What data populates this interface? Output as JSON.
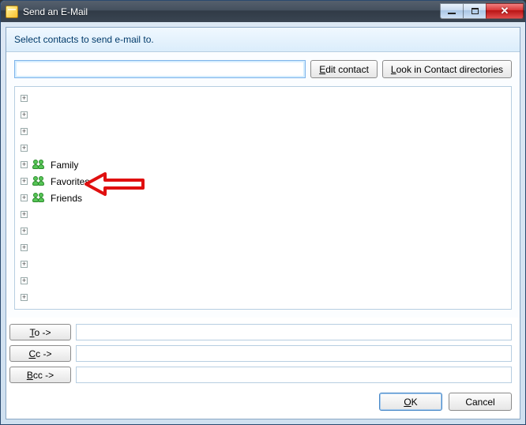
{
  "window": {
    "title": "Send an E-Mail"
  },
  "instruction": "Select contacts to send e-mail to.",
  "search": {
    "value": "",
    "placeholder": ""
  },
  "buttons": {
    "edit_contact": "Edit contact",
    "look_in_dirs": "Look in Contact directories",
    "to": "To ->",
    "cc": "Cc ->",
    "bcc": "Bcc ->",
    "ok": "OK",
    "cancel": "Cancel"
  },
  "contact_list": [
    {
      "type": "contact",
      "label": ""
    },
    {
      "type": "contact",
      "label": ""
    },
    {
      "type": "contact",
      "label": ""
    },
    {
      "type": "contact",
      "label": ""
    },
    {
      "type": "group",
      "label": "Family"
    },
    {
      "type": "group",
      "label": "Favorites"
    },
    {
      "type": "group",
      "label": "Friends"
    },
    {
      "type": "contact",
      "label": ""
    },
    {
      "type": "contact",
      "label": ""
    },
    {
      "type": "contact",
      "label": ""
    },
    {
      "type": "contact",
      "label": ""
    },
    {
      "type": "contact",
      "label": ""
    },
    {
      "type": "contact",
      "label": ""
    }
  ],
  "fields": {
    "to": "",
    "cc": "",
    "bcc": ""
  },
  "annotation": {
    "arrow_target": "Favorites"
  }
}
